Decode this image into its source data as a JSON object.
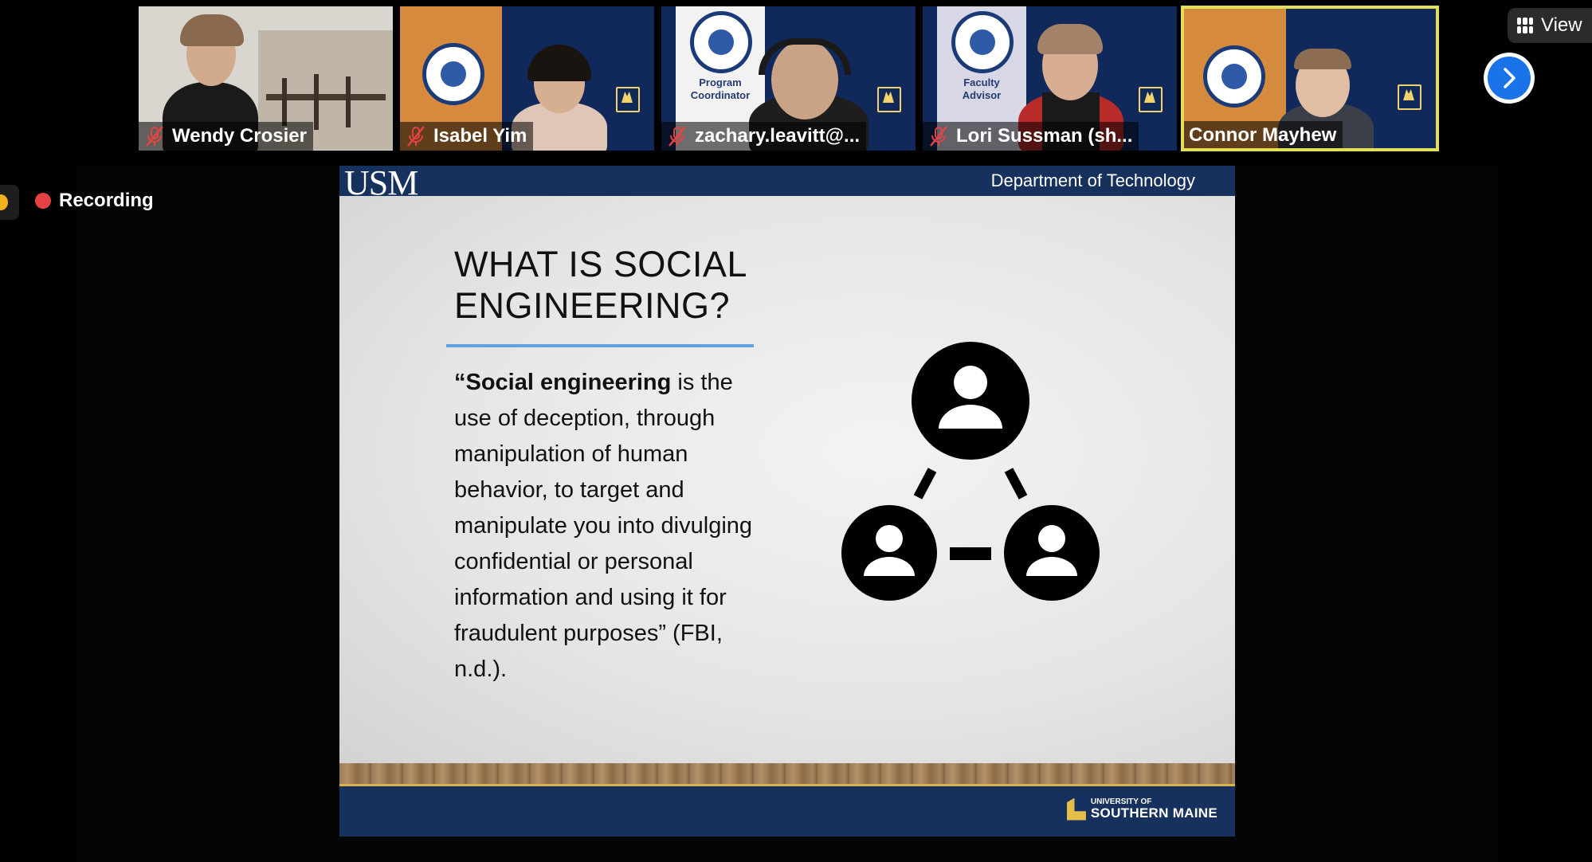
{
  "participants": [
    {
      "name": "Wendy Crosier",
      "muted": true
    },
    {
      "name": "Isabel Yim",
      "muted": true
    },
    {
      "name": "zachary.leavitt@...",
      "muted": true,
      "banner": [
        "Program",
        "Coordinator"
      ]
    },
    {
      "name": "Lori Sussman (sh...",
      "muted": true,
      "banner": [
        "Faculty",
        "Advisor"
      ]
    },
    {
      "name": "Connor Mayhew",
      "muted": false,
      "active": true
    }
  ],
  "toolbar": {
    "view_label": "View"
  },
  "recording": {
    "label": "Recording"
  },
  "slide": {
    "logo_text": "USM",
    "header_right": "Department of Technology",
    "title_line1": "WHAT IS SOCIAL",
    "title_line2": "ENGINEERING?",
    "body_bold": "“Social engineering",
    "body_rest": " is the use of deception, through manipulation of human behavior, to target and manipulate you into divulging confidential or personal information and using it for fraudulent purposes” (FBI, n.d.).",
    "footer_small": "UNIVERSITY OF",
    "footer_big": "SOUTHERN MAINE"
  },
  "colors": {
    "usm_navy": "#17315f",
    "accent_blue": "#5ea3dd",
    "active_border": "#e2e05a",
    "record_red": "#e54343"
  }
}
